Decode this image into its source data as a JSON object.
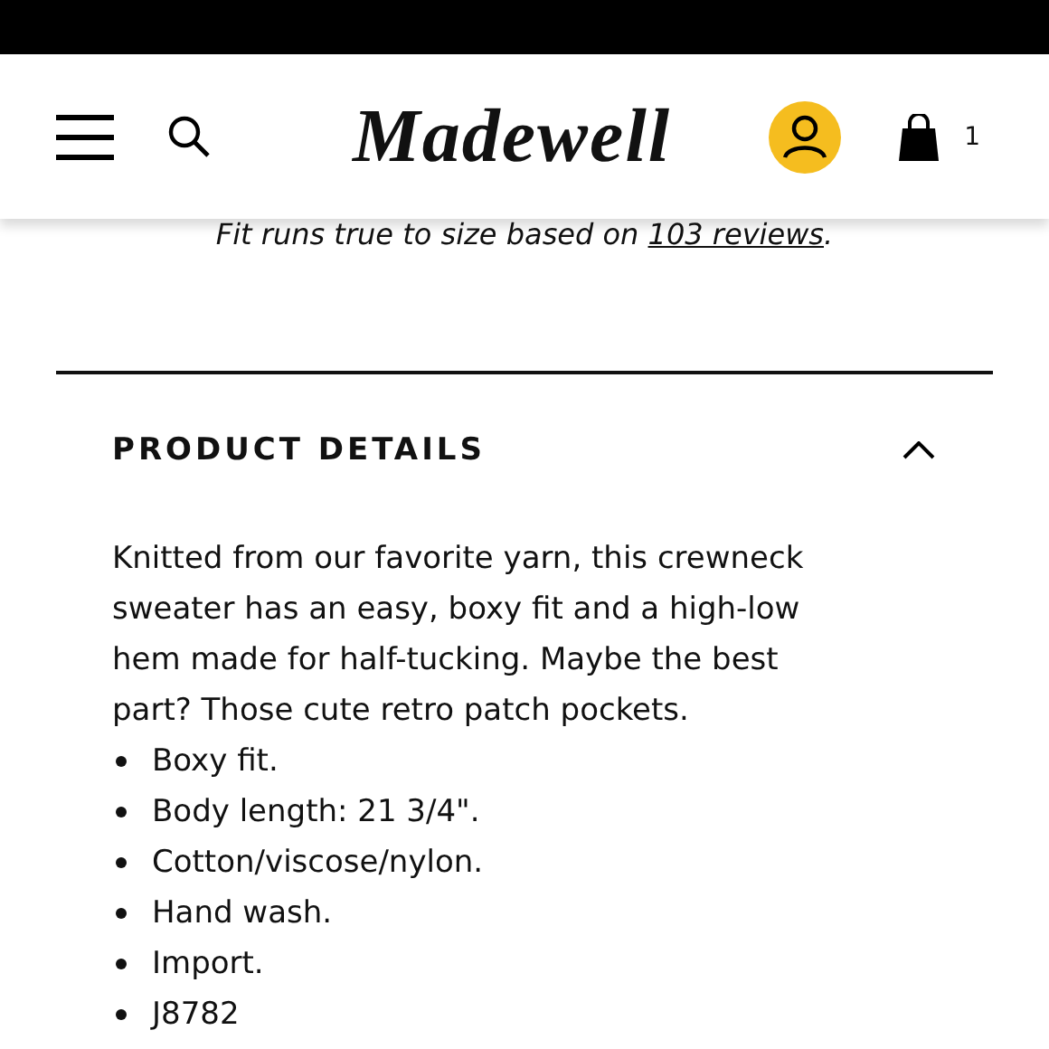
{
  "header": {
    "logo": "Madewell",
    "cart_count": "1"
  },
  "fit_note": {
    "text": "Fit runs true to size based on ",
    "link": "103 reviews",
    "suffix": "."
  },
  "details": {
    "title": "PRODUCT DETAILS",
    "expanded": true,
    "description": "Knitted from our favorite yarn, this crewneck sweater has an easy, boxy fit and a high-low hem made for half-tucking. Maybe the best part? Those cute retro patch pockets.",
    "bullets": [
      "Boxy fit.",
      "Body length: 21 3/4\".",
      "Cotton/viscose/nylon.",
      "Hand wash.",
      "Import.",
      "J8782"
    ]
  }
}
